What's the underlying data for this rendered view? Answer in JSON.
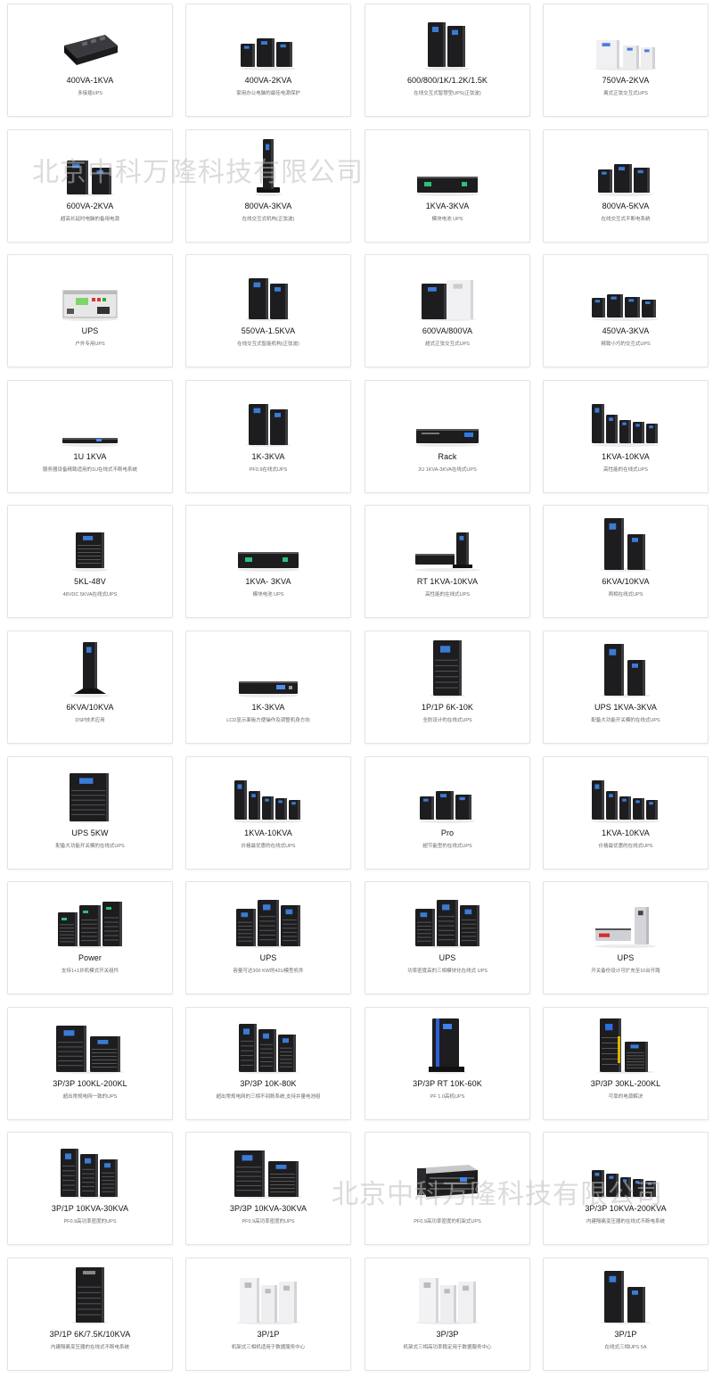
{
  "products": [
    {
      "title": "400VA-1KVA",
      "desc": "多接插UPS",
      "icon": "desktop-ups-icon",
      "kind": "desktop"
    },
    {
      "title": "400VA-2KVA",
      "desc": "家用办公电脑的最佳电源保护",
      "icon": "ups-tower-group-icon",
      "kind": "tower-group3"
    },
    {
      "title": "600/800/1K/1.2K/1.5K",
      "desc": "在线交互式智慧型UPS(正弦波)",
      "icon": "ups-tower-pair-icon",
      "kind": "tower-pair"
    },
    {
      "title": "750VA-2KVA",
      "desc": "离式正弦交互式UPS",
      "icon": "white-ups-group-icon",
      "kind": "white-group"
    },
    {
      "title": "600VA-2KVA",
      "desc": "超高长延时电脑的备用电源",
      "icon": "ups-tower-pair-icon",
      "kind": "tower-pair-b"
    },
    {
      "title": "800VA-3KVA",
      "desc": "在线交互式机构(正弦波)",
      "icon": "slim-tower-ups-icon",
      "kind": "slim-tower"
    },
    {
      "title": "1KVA-3KVA",
      "desc": "模块电池 UPS",
      "icon": "rack-ups-icon",
      "kind": "rack-green"
    },
    {
      "title": "800VA-5KVA",
      "desc": "在线交互式不断电系统",
      "icon": "ups-tower-group-icon",
      "kind": "tower-group3"
    },
    {
      "title": "UPS",
      "desc": "户外专用UPS",
      "icon": "outdoor-ups-panel-icon",
      "kind": "panel"
    },
    {
      "title": "550VA-1.5KVA",
      "desc": "在线交互式智能机构(正弦波)",
      "icon": "ups-tower-pair-icon",
      "kind": "tower-pair-c"
    },
    {
      "title": "600VA/800VA",
      "desc": "超式正弦交互式UPS",
      "icon": "mixed-ups-pair-icon",
      "kind": "bw-pair"
    },
    {
      "title": "450VA-3KVA",
      "desc": "精致小巧的交互式UPS",
      "icon": "ups-tower-group-icon",
      "kind": "tower-group4"
    },
    {
      "title": "1U 1KVA",
      "desc": "服务器设备精致适用的1U在线式不断电系统",
      "icon": "1u-rack-ups-icon",
      "kind": "thin-rack"
    },
    {
      "title": "1K-3KVA",
      "desc": "PF0.9在线式UPS",
      "icon": "ups-tower-pair-icon",
      "kind": "tower-pair-c"
    },
    {
      "title": "Rack",
      "desc": "2U 1KVA-3KVA在线式UPS",
      "icon": "rack-ups-icon",
      "kind": "rack-blue"
    },
    {
      "title": "1KVA-10KVA",
      "desc": "高性能的在线式UPS",
      "icon": "ups-tower-group-icon",
      "kind": "tower-group5"
    },
    {
      "title": "5KL-48V",
      "desc": "48VDC 5KVA在线式UPS",
      "icon": "tower-ups-icon",
      "kind": "tower-single"
    },
    {
      "title": "1KVA- 3KVA",
      "desc": "模块电池 UPS",
      "icon": "rack-ups-icon",
      "kind": "rack-green"
    },
    {
      "title": "RT 1KVA-10KVA",
      "desc": "高性能的在线式UPS",
      "icon": "rack-tower-ups-icon",
      "kind": "rack-tower"
    },
    {
      "title": "6KVA/10KVA",
      "desc": "两相在线式UPS",
      "icon": "ups-tower-pair-icon",
      "kind": "tower-pair-tall"
    },
    {
      "title": "6KVA/10KVA",
      "desc": "DSP技术应用",
      "icon": "tower-ups-icon",
      "kind": "tower-stand"
    },
    {
      "title": "1K-3KVA",
      "desc": "LCD显示面板方便操作及调整机身方向",
      "icon": "rack-ups-icon",
      "kind": "rack-lcd"
    },
    {
      "title": "1P/1P 6K-10K",
      "desc": "全防设计的在线式UPS",
      "icon": "tower-ups-icon",
      "kind": "tower-louver"
    },
    {
      "title": "UPS 1KVA-3KVA",
      "desc": "配备大功能开关模的在线式UPS",
      "icon": "ups-tower-pair-icon",
      "kind": "tower-pair-tall"
    },
    {
      "title": "UPS 5KW",
      "desc": "配备大功能开关模的在线式UPS",
      "icon": "tower-ups-icon",
      "kind": "tower-wide"
    },
    {
      "title": "1KVA-10KVA",
      "desc": "价格最优惠的在线式UPS",
      "icon": "ups-tower-group-icon",
      "kind": "tower-group5"
    },
    {
      "title": "Pro",
      "desc": "超节能型的在线式UPS",
      "icon": "ups-tower-group-icon",
      "kind": "tower-group3"
    },
    {
      "title": "1KVA-10KVA",
      "desc": "价格最优惠的在线式UPS",
      "icon": "ups-tower-group-icon",
      "kind": "tower-group5"
    },
    {
      "title": "Power",
      "desc": "支持1+1并机模式开关组件",
      "icon": "modular-ups-icon",
      "kind": "modular"
    },
    {
      "title": "UPS",
      "desc": "容量可达300 KW的42U模型机件",
      "icon": "cabinet-ups-icon",
      "kind": "cabinet-group"
    },
    {
      "title": "UPS",
      "desc": "功率密度高的三相模块化在线式 UPS",
      "icon": "cabinet-ups-icon",
      "kind": "cabinet-group"
    },
    {
      "title": "UPS",
      "desc": "开关备份设计可扩充至10台开路",
      "icon": "rack-tower-ups-icon",
      "kind": "rack-tower-silver"
    },
    {
      "title": "3P/3P 100KL-200KL",
      "desc": "超出常规电网一致的UPS",
      "icon": "ups-tower-pair-icon",
      "kind": "tower-pair-wide"
    },
    {
      "title": "3P/3P 10K-80K",
      "desc": "超出常规电网的三相不间断系统,支持并量电池组",
      "icon": "ups-tower-group-icon",
      "kind": "tower-group3-tall"
    },
    {
      "title": "3P/3P RT 10K-60K",
      "desc": "PF 1.0高机UPS",
      "icon": "tower-ups-icon",
      "kind": "tower-blue"
    },
    {
      "title": "3P/3P 30KL-200KL",
      "desc": "可靠的电源解决",
      "icon": "ups-tower-pair-icon",
      "kind": "tower-pair-color"
    },
    {
      "title": "3P/1P 10KVA-30KVA",
      "desc": "PF0.9高功率密度的UPS",
      "icon": "ups-tower-group-icon",
      "kind": "tower-group3-tall"
    },
    {
      "title": "3P/3P 10KVA-30KVA",
      "desc": "PF0.9高功率密度的UPS",
      "icon": "ups-tower-pair-icon",
      "kind": "tower-pair-wide"
    },
    {
      "title": "",
      "desc": "PF0.9高功率密度的机架式UPS",
      "icon": "rack-ups-icon",
      "kind": "rack-box"
    },
    {
      "title": "3P/3P 10KVA-200KVA",
      "desc": "内建隔离变压器的在线式不断电系统",
      "icon": "ups-tower-group-icon",
      "kind": "tower-group-flat"
    },
    {
      "title": "3P/1P 6K/7.5K/10KVA",
      "desc": "内建隔离变压器的在线式不断电系统",
      "icon": "tower-ups-icon",
      "kind": "tower-louver-tall"
    },
    {
      "title": "3P/1P",
      "desc": "机架式三相机适用于数据服务中心",
      "icon": "white-cabinet-group-icon",
      "kind": "white-cabinets"
    },
    {
      "title": "3P/3P",
      "desc": "机架式三相高功率稳定用于数据服务中心",
      "icon": "white-cabinet-group-icon",
      "kind": "white-cabinets"
    },
    {
      "title": "3P/1P",
      "desc": "在线式三相UPS 5A",
      "icon": "ups-tower-pair-icon",
      "kind": "tower-pair-tall"
    }
  ],
  "watermarks": [
    {
      "text": "北京中科万隆科技有限公司"
    },
    {
      "text": "北京中科万隆科技有限公司"
    }
  ]
}
